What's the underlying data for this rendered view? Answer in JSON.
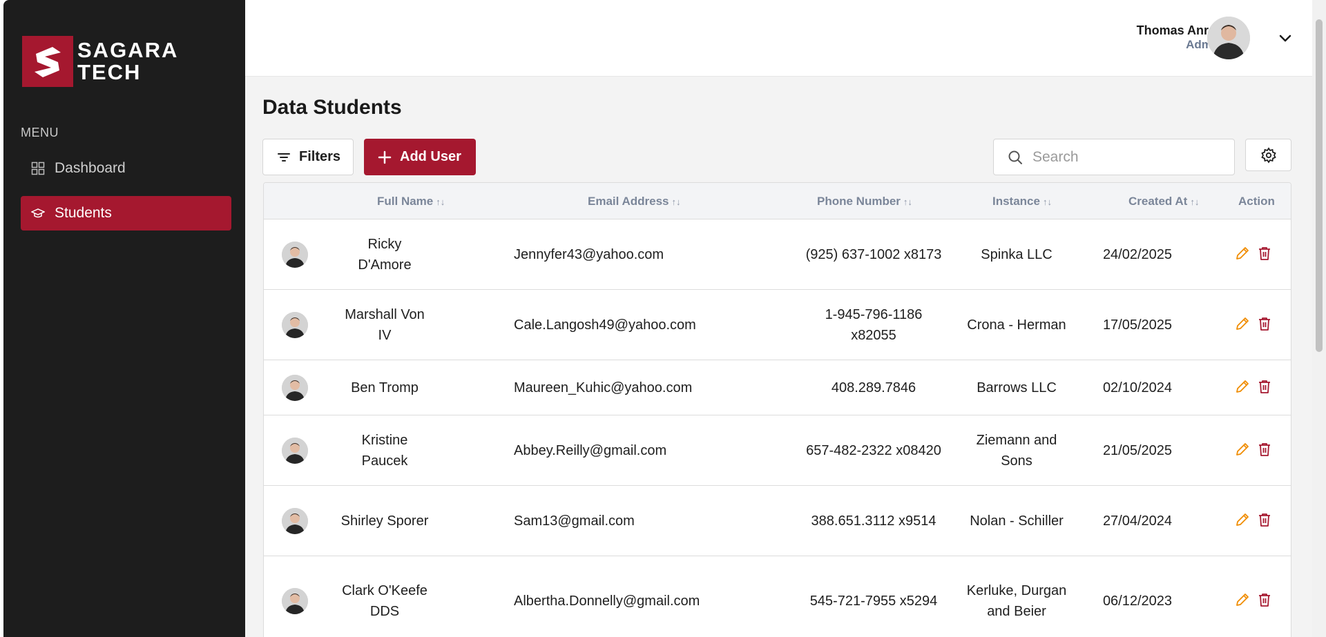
{
  "brand": {
    "line1": "SAGARA",
    "line2": "TECH",
    "color": "#a5182f"
  },
  "sidebar": {
    "menu_label": "MENU",
    "items": [
      {
        "label": "Dashboard",
        "icon": "grid-icon",
        "active": false
      },
      {
        "label": "Students",
        "icon": "graduation-cap-icon",
        "active": true
      }
    ]
  },
  "header": {
    "user_name": "Thomas Anree",
    "user_role": "Admin",
    "dropdown_icon": "chevron-down-icon"
  },
  "main": {
    "title": "Data Students",
    "filters_label": "Filters",
    "add_user_label": "Add User",
    "search_placeholder": "Search",
    "search_value": ""
  },
  "table": {
    "columns": [
      "Full Name",
      "Email Address",
      "Phone Number",
      "Instance",
      "Created At",
      "Action"
    ],
    "rows": [
      {
        "name": "Ricky D'Amore",
        "email": "Jennyfer43@yahoo.com",
        "phone": "(925) 637-1002 x8173",
        "instance": "Spinka LLC",
        "created": "24/02/2025"
      },
      {
        "name": "Marshall Von IV",
        "email": "Cale.Langosh49@yahoo.com",
        "phone": "1-945-796-1186 x82055",
        "instance": "Crona - Herman",
        "created": "17/05/2025"
      },
      {
        "name": "Ben Tromp",
        "email": "Maureen_Kuhic@yahoo.com",
        "phone": "408.289.7846",
        "instance": "Barrows LLC",
        "created": "02/10/2024"
      },
      {
        "name": "Kristine Paucek",
        "email": "Abbey.Reilly@gmail.com",
        "phone": "657-482-2322 x08420",
        "instance": "Ziemann and Sons",
        "created": "21/05/2025"
      },
      {
        "name": "Shirley Sporer",
        "email": "Sam13@gmail.com",
        "phone": "388.651.3112 x9514",
        "instance": "Nolan - Schiller",
        "created": "27/04/2024"
      },
      {
        "name": "Clark O'Keefe DDS",
        "email": "Albertha.Donnelly@gmail.com",
        "phone": "545-721-7955 x5294",
        "instance": "Kerluke, Durgan and Beier",
        "created": "06/12/2023"
      }
    ]
  },
  "colors": {
    "accent": "#a5182f",
    "edit": "#f08c00",
    "delete": "#a5182f"
  }
}
